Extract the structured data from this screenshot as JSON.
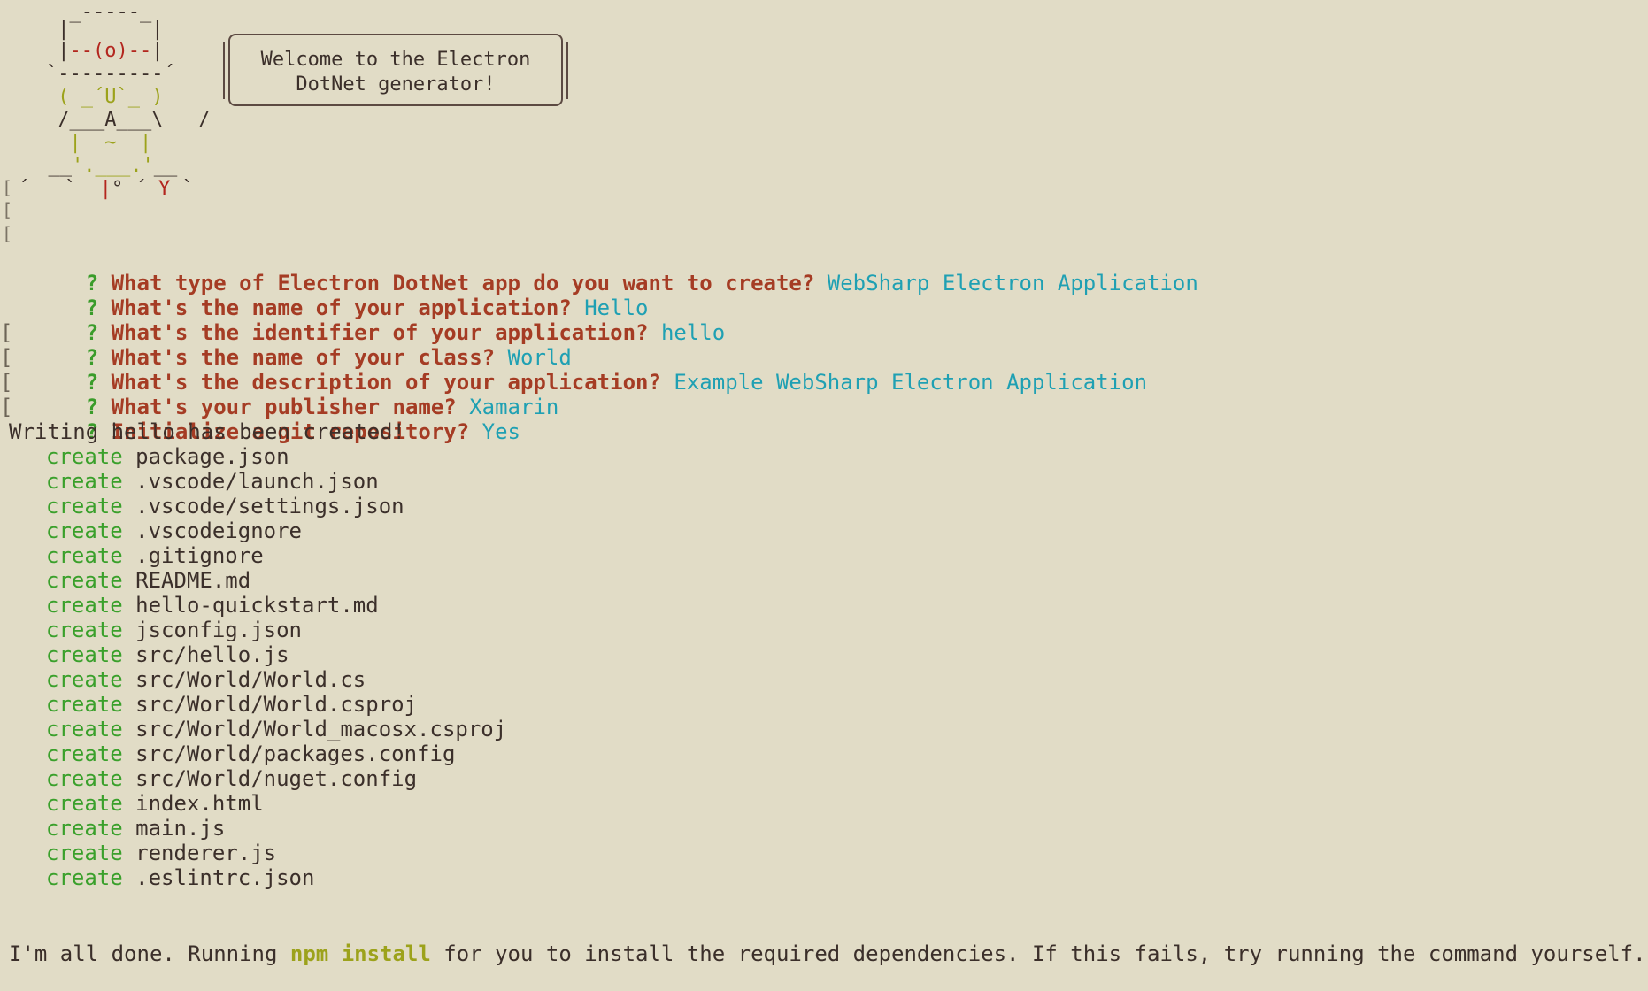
{
  "welcome_box": {
    "line1": "Welcome to the Electron",
    "line2": "DotNet generator!"
  },
  "questions": [
    {
      "question": "What type of Electron DotNet app do you want to create?",
      "answer": "WebSharp Electron Application"
    },
    {
      "question": "What's the name of your application?",
      "answer": "Hello"
    },
    {
      "question": "What's the identifier of your application?",
      "answer": "hello"
    },
    {
      "question": "What's the name of your class?",
      "answer": "World"
    },
    {
      "question": "What's the description of your application?",
      "answer": "Example WebSharp Electron Application"
    },
    {
      "question": "What's your publisher name?",
      "answer": "Xamarin"
    },
    {
      "question": "Initialize a git repository?",
      "answer": "Yes"
    }
  ],
  "question_mark": "?",
  "writing_line": "Writing hello has been created!",
  "create_word": "create",
  "created_files": [
    "package.json",
    ".vscode/launch.json",
    ".vscode/settings.json",
    ".vscodeignore",
    ".gitignore",
    "README.md",
    "hello-quickstart.md",
    "jsconfig.json",
    "src/hello.js",
    "src/World/World.cs",
    "src/World/World.csproj",
    "src/World/World_macosx.csproj",
    "src/World/packages.config",
    "src/World/nuget.config",
    "index.html",
    "main.js",
    "renderer.js",
    ".eslintrc.json"
  ],
  "footer": {
    "before": "I'm all done. Running ",
    "command": "npm install",
    "after": " for you to install the required dependencies. If this fails, try running the command yourself."
  },
  "colors": {
    "background": "#e1dcc6",
    "question_text": "#a53c24",
    "answer": "#1fa0b3",
    "create": "#3aa02b",
    "npm": "#9ca21b"
  }
}
